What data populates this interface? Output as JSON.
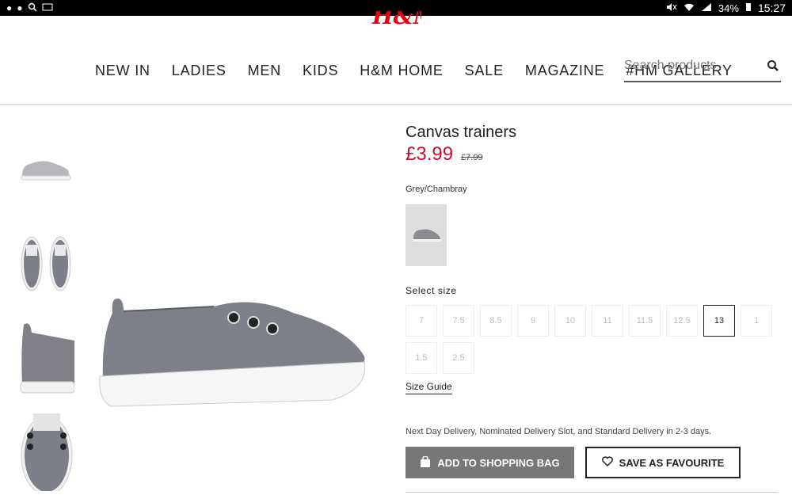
{
  "statusbar": {
    "battery": "34%",
    "time": "15:27"
  },
  "brand": {
    "logo_text": "H&M"
  },
  "nav": {
    "items": [
      "NEW IN",
      "LADIES",
      "MEN",
      "KIDS",
      "H&M HOME",
      "SALE",
      "MAGAZINE",
      "#HM GALLERY"
    ]
  },
  "search": {
    "placeholder": "Search products"
  },
  "product": {
    "title": "Canvas trainers",
    "price": "£3.99",
    "old_price": "£7.99",
    "color_name": "Grey/Chambray",
    "size_label": "Select size",
    "sizes": [
      "7",
      "7.5",
      "8.5",
      "9",
      "10",
      "11",
      "11.5",
      "12.5",
      "13",
      "1",
      "1.5",
      "2.5"
    ],
    "selected_size": "13",
    "size_guide": "Size Guide",
    "delivery": "Next Day Delivery, Nominated Delivery Slot, and Standard Delivery in 2-3 days."
  },
  "actions": {
    "add_to_bag": "ADD TO SHOPPING BAG",
    "save_favourite": "SAVE AS FAVOURITE"
  },
  "colors": {
    "price_red": "#c8102e",
    "brand_red": "#e50010",
    "bag_button_bg": "#777777"
  }
}
